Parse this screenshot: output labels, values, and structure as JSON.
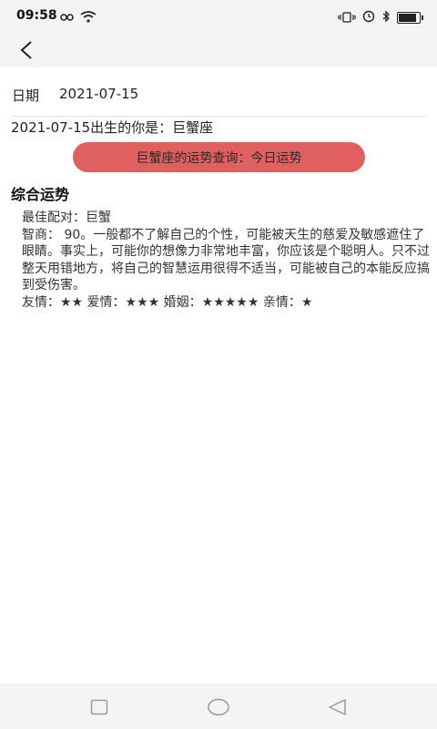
{
  "status_bar": {
    "time": "09:58"
  },
  "header": {
    "back_icon": "chevron-left-icon"
  },
  "form": {
    "date_label": "日期",
    "date_value": "2021-07-15"
  },
  "result": {
    "birth_line": "2021-07-15出生的你是：巨蟹座",
    "query_button_label": "巨蟹座的运势查询：今日运势",
    "section_title": "综合运势",
    "best_match": "最佳配对：巨蟹",
    "iq_text": "智商： 90。一般都不了解自己的个性，可能被天生的慈爱及敏感遮住了眼睛。事实上，可能你的想像力非常地丰富，你应该是个聪明人。只不过整天用错地方，将自己的智慧运用很得不适当，可能被自己的本能反应搞到受伤害。",
    "ratings_text": "友情：★★ 爱情：★★★ 婚姻：★★★★★ 亲情：★"
  },
  "colors": {
    "accent": "#e06060",
    "bar_bg": "#f4f4f4"
  }
}
